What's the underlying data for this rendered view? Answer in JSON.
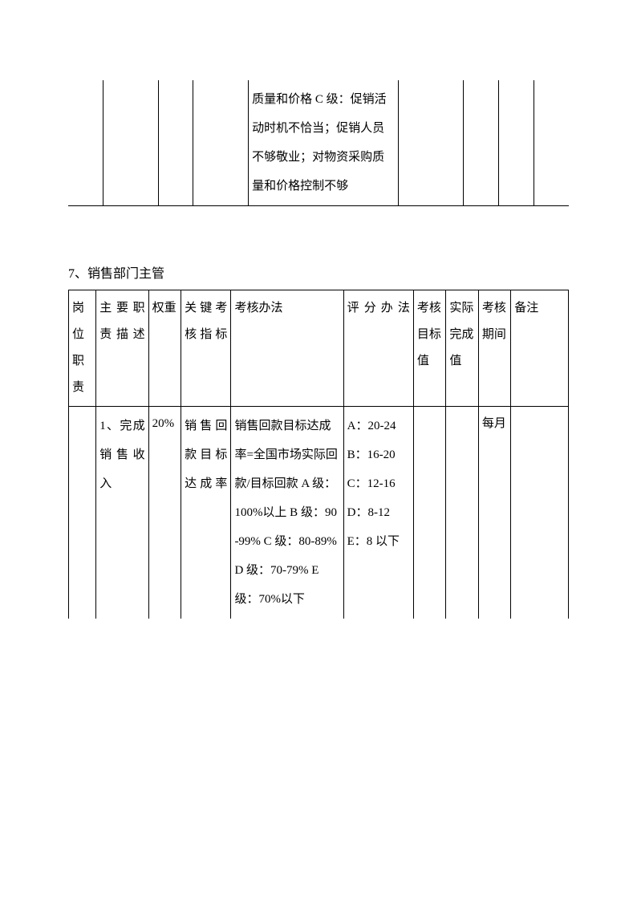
{
  "top_table": {
    "col4_text": "质量和价格\nC 级：促销活动时机不恰当；促销人员不够敬业；对物资采购质量和价格控制不够"
  },
  "section_heading": "7、销售部门主管",
  "table2": {
    "headers": {
      "c1": "岗位职责",
      "c2": "主要职责描述",
      "c3": "权重",
      "c4": "关键考核指标",
      "c5": "考核办法",
      "c6": "评分办法",
      "c7": "考核目标值",
      "c8": "实际完成值",
      "c9": "考核期间",
      "c10": "备注"
    },
    "row1": {
      "c2": "1、完成销售收入",
      "c3": "20%",
      "c4": "销售回款目标达成率",
      "c5": "销售回款目标达成率=全国市场实际回款/目标回款\nA 级：100%以上\nB 级：90-99%\nC 级：80-89%\nD 级：70-79%\nE 级：70%以下",
      "c6": "A：20-24\nB：16-20\nC：12-16\nD：8-12\nE：8 以下",
      "c9": "每月"
    }
  }
}
